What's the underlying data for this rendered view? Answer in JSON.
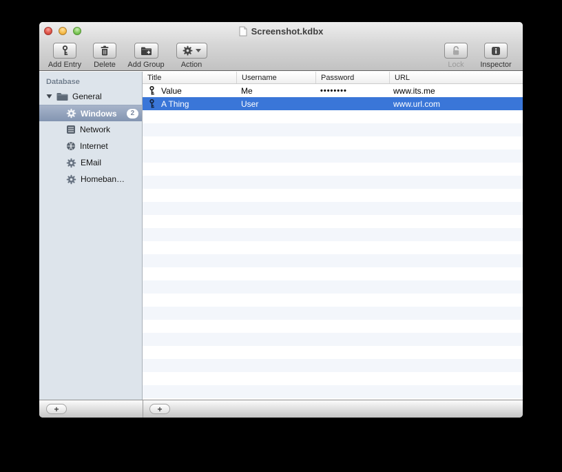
{
  "window": {
    "title": "Screenshot.kdbx"
  },
  "toolbar": {
    "buttons": [
      {
        "label": "Add Entry"
      },
      {
        "label": "Delete"
      },
      {
        "label": "Add Group"
      },
      {
        "label": "Action"
      }
    ],
    "right_buttons": [
      {
        "label": "Lock",
        "disabled": true
      },
      {
        "label": "Inspector",
        "disabled": false
      }
    ]
  },
  "sidebar": {
    "header": "Database",
    "items": [
      {
        "label": "General",
        "type": "folder",
        "expanded": true
      },
      {
        "label": "Windows",
        "badge": "2",
        "selected": true
      },
      {
        "label": "Network"
      },
      {
        "label": "Internet"
      },
      {
        "label": "EMail"
      },
      {
        "label": "Homeban…"
      }
    ]
  },
  "table": {
    "columns": [
      {
        "label": "Title"
      },
      {
        "label": "Username"
      },
      {
        "label": "Password"
      },
      {
        "label": "URL"
      }
    ],
    "rows": [
      {
        "title": "Value",
        "username": "Me",
        "password": "••••••••",
        "url": "www.its.me",
        "selected": false
      },
      {
        "title": "A Thing",
        "username": "User",
        "password": "",
        "url": "www.url.com",
        "selected": true
      }
    ]
  },
  "bottombar": {
    "sidebar_add_label": "+",
    "table_add_label": "+"
  },
  "colors": {
    "selection_blue": "#3a76d8",
    "sidebar_selection_top": "#a7b4ca",
    "sidebar_selection_bottom": "#8395b1",
    "row_stripe": "#f3f6fb",
    "sidebar_bg": "#dde4eb"
  }
}
